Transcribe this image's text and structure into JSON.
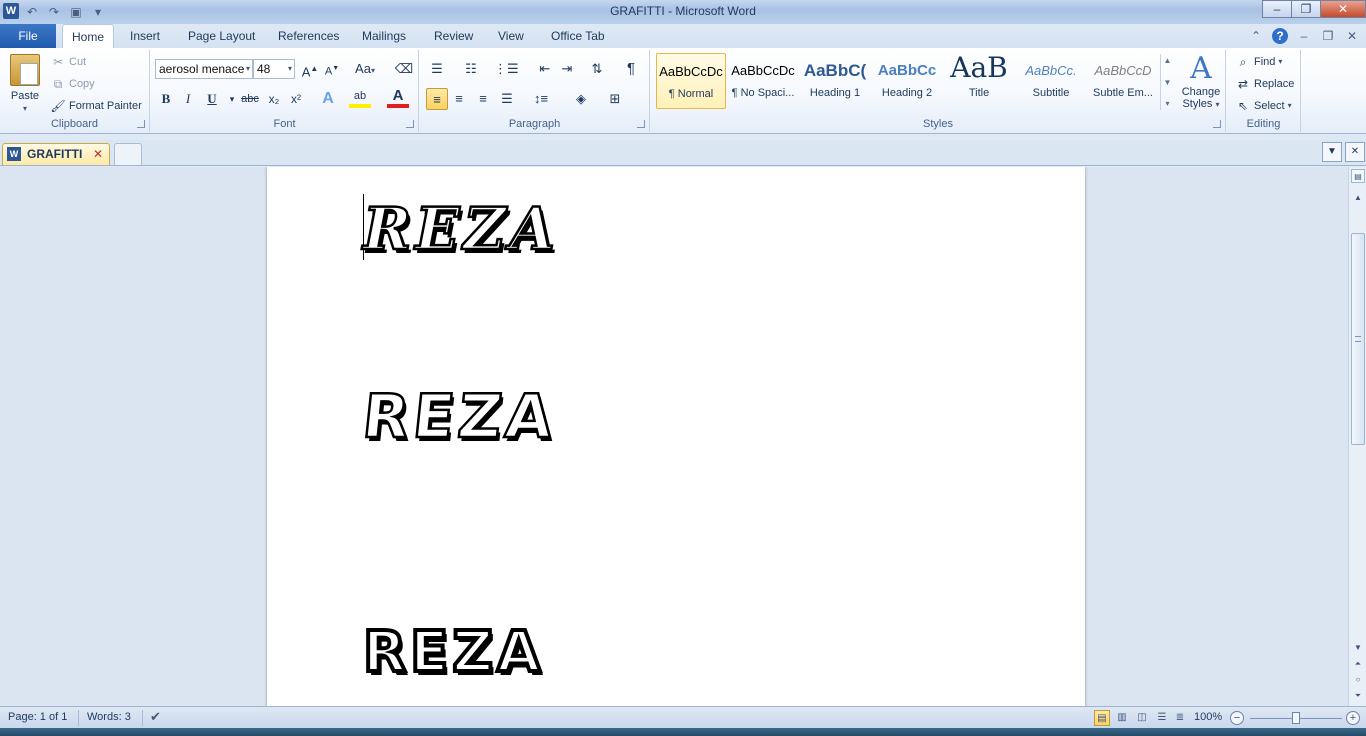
{
  "window": {
    "title": "GRAFITTI  -  Microsoft Word",
    "app_icon": "W",
    "controls": {
      "minimize": "–",
      "maximize": "❐",
      "close": "✕"
    }
  },
  "ribbon_tabs": [
    "File",
    "Home",
    "Insert",
    "Page Layout",
    "References",
    "Mailings",
    "Review",
    "View",
    "Office Tab"
  ],
  "clipboard": {
    "paste": "Paste",
    "cut": "Cut",
    "copy": "Copy",
    "format_painter": "Format Painter",
    "group_label": "Clipboard"
  },
  "font": {
    "font_name": "aerosol menace",
    "font_size": "48",
    "grow": "A",
    "shrink": "A",
    "change_case": "Aa",
    "bold": "B",
    "italic": "I",
    "underline": "U",
    "strike": "abc",
    "subscript": "x₂",
    "superscript": "x²",
    "text_effects": "A",
    "highlight": "ab",
    "font_color": "A",
    "group_label": "Font"
  },
  "paragraph": {
    "show_marks": "¶",
    "group_label": "Paragraph"
  },
  "styles": {
    "items": [
      {
        "sample": "AaBbCcDc",
        "name": "¶ Normal"
      },
      {
        "sample": "AaBbCcDc",
        "name": "¶ No Spaci..."
      },
      {
        "sample": "AaBbC(",
        "name": "Heading 1"
      },
      {
        "sample": "AaBbCc",
        "name": "Heading 2"
      },
      {
        "sample": "AaB",
        "name": "Title"
      },
      {
        "sample": "AaBbCc.",
        "name": "Subtitle"
      },
      {
        "sample": "AaBbCcD",
        "name": "Subtle Em..."
      }
    ],
    "change_styles": "Change Styles",
    "group_label": "Styles"
  },
  "editing": {
    "find": "Find",
    "replace": "Replace",
    "select": "Select",
    "group_label": "Editing"
  },
  "doc_tab": {
    "name": "GRAFITTI",
    "close": "✕"
  },
  "document": {
    "lines": [
      "REZA",
      "REZA",
      "REZA"
    ]
  },
  "status": {
    "page": "Page: 1 of 1",
    "words": "Words: 3",
    "zoom": "100%"
  }
}
